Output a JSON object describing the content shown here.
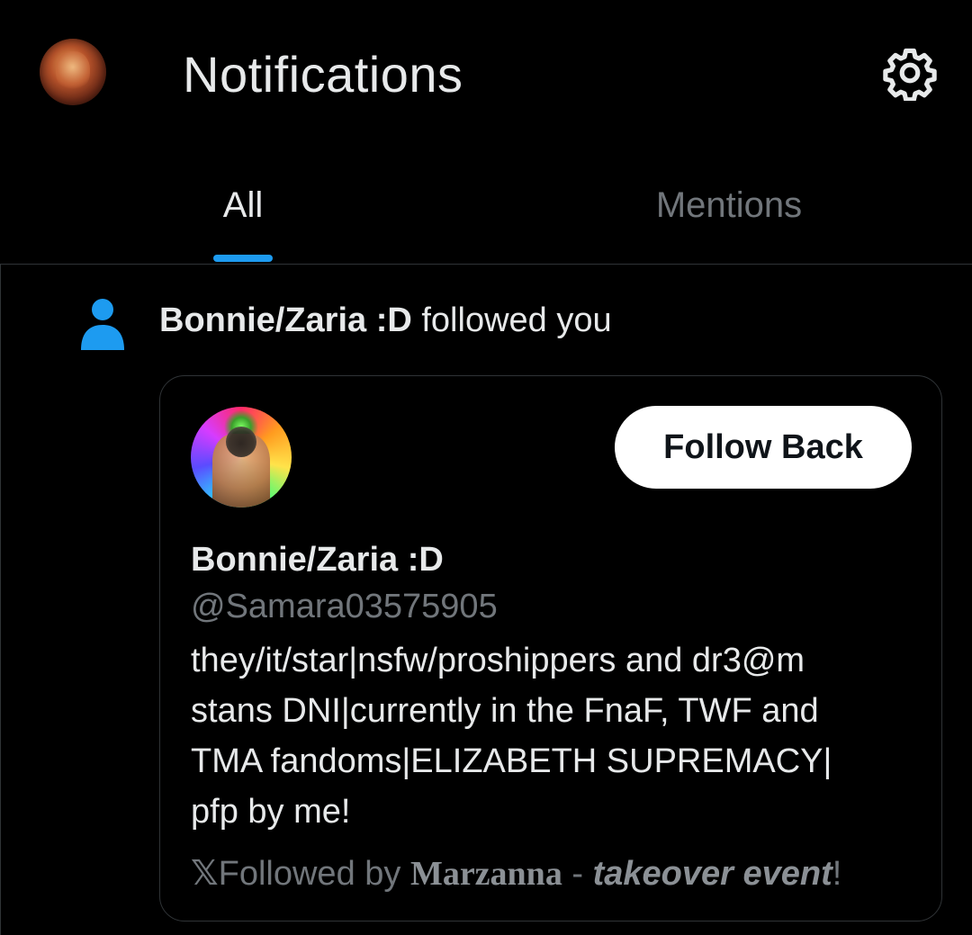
{
  "header": {
    "title": "Notifications",
    "settings_icon": "gear-icon"
  },
  "tabs": [
    {
      "label": "All",
      "selected": true
    },
    {
      "label": "Mentions",
      "selected": false
    }
  ],
  "colors": {
    "accent": "#1d9bf0",
    "background": "#000000",
    "text_primary": "#e7e9ea",
    "text_secondary": "#71767b",
    "border": "#2f3336"
  },
  "notification": {
    "icon": "person-icon",
    "actor_name": "Bonnie/Zaria :D",
    "action_text": " followed you",
    "card": {
      "follow_button_label": "Follow Back",
      "display_name": "Bonnie/Zaria :D",
      "handle": "@Samara03575905",
      "bio_lines": [
        "they/it/star|nsfw/proshippers and dr3@m",
        "stans DNI|currently in the FnaF, TWF and",
        "TMA fandoms|ELIZABETH SUPREMACY|",
        "pfp by me!"
      ],
      "followed_by": {
        "x_glyph": "𝕏",
        "prefix": "Followed by ",
        "name_part1": "Marzanna",
        "separator": " - ",
        "name_part2": "takeover event",
        "suffix": "!"
      }
    }
  }
}
